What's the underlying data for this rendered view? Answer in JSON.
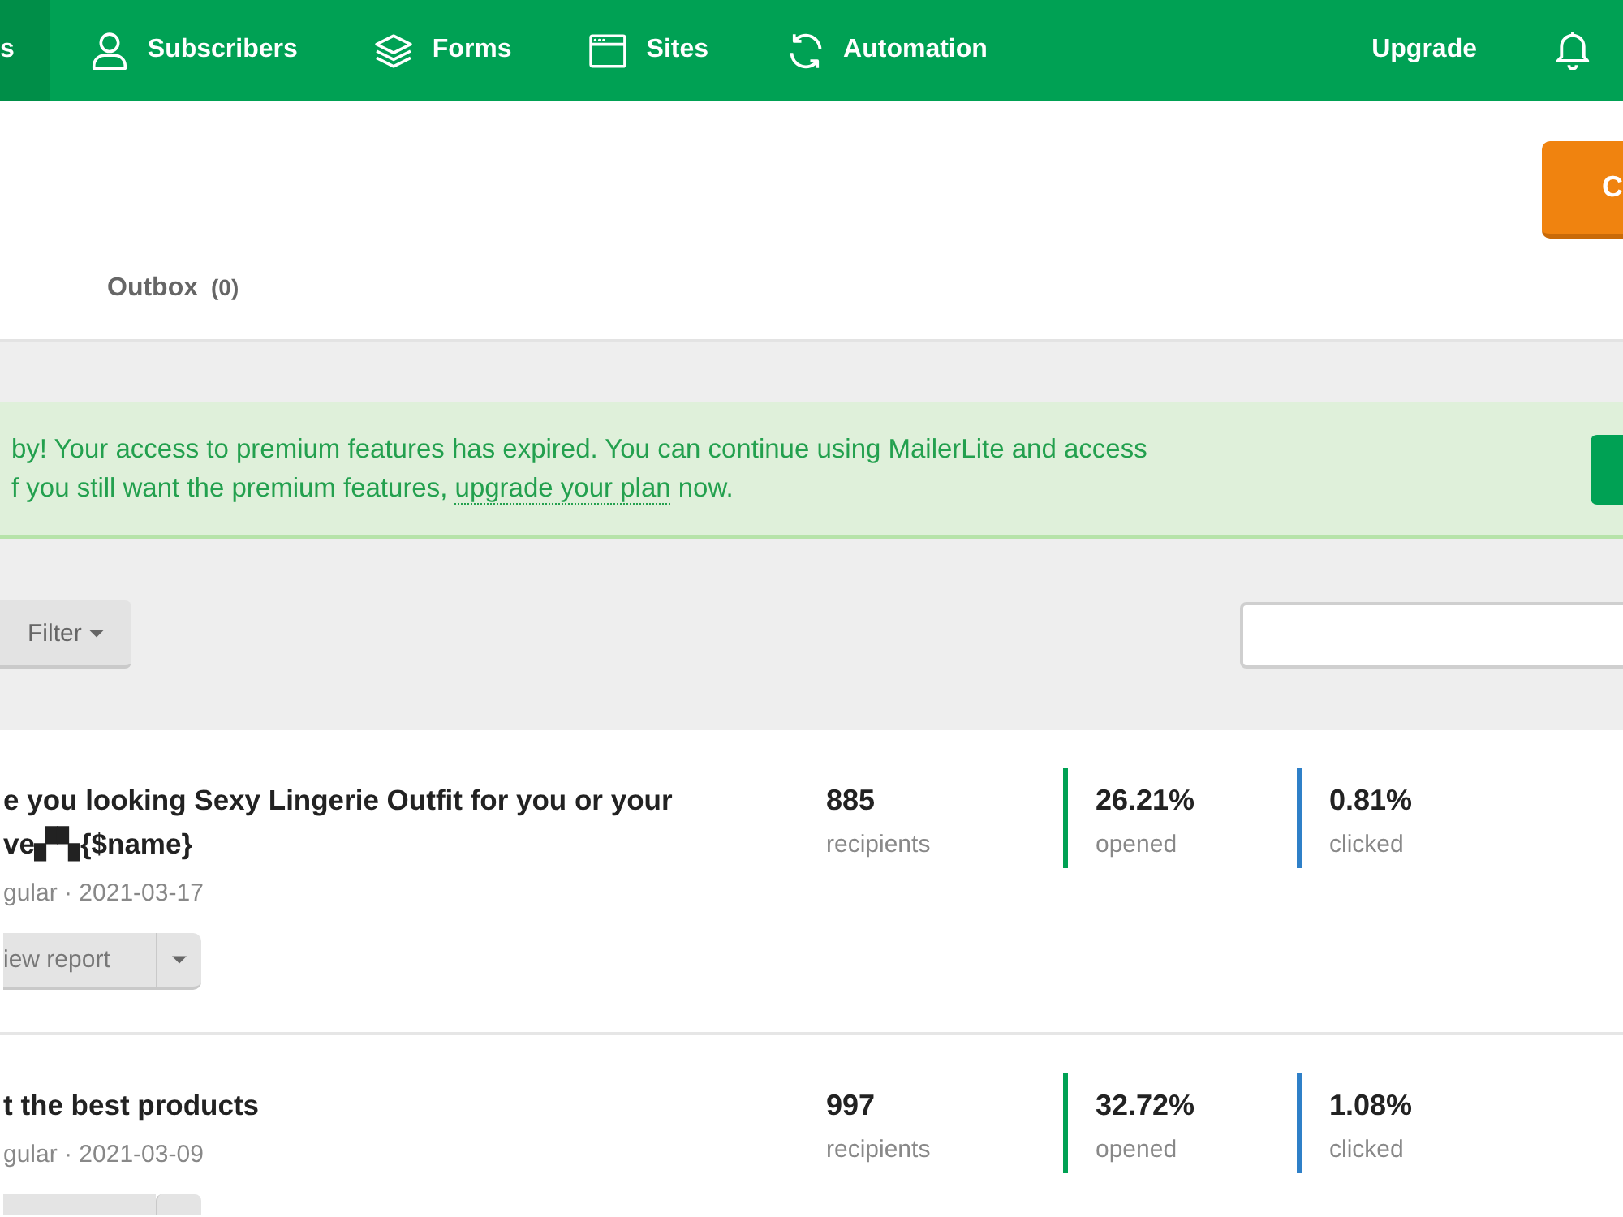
{
  "nav": {
    "tabs": [
      {
        "label": "s",
        "selected": true
      },
      {
        "label": "Subscribers",
        "selected": false
      },
      {
        "label": "Forms",
        "selected": false
      },
      {
        "label": "Sites",
        "selected": false
      },
      {
        "label": "Automation",
        "selected": false
      }
    ],
    "upgrade": "Upgrade"
  },
  "header": {
    "create_button": "C",
    "tabs": [
      {
        "label": "Outbox",
        "count": "(0)",
        "selected": false
      }
    ]
  },
  "alert": {
    "line_1": "by! Your access to premium features has expired. You can continue using MailerLite and access",
    "line_2": {
      "before": "f you still want the premium features, ",
      "link": "upgrade your plan",
      "after": " now."
    }
  },
  "toolbar": {
    "filter_button": "Filter"
  },
  "campaigns": [
    {
      "title_lines": [
        "e you looking Sexy Lingerie Outfit for you or your",
        "ve▞▚{$name}"
      ],
      "meta": "gular · 2021-03-17",
      "report_button": "iew report",
      "stats": [
        {
          "value": "885",
          "label": "recipients"
        },
        {
          "value": "26.21%",
          "label": "opened",
          "color": "#00a154"
        },
        {
          "value": "0.81%",
          "label": "clicked",
          "color": "#2f80c8"
        }
      ]
    },
    {
      "title_lines": [
        "t the best products"
      ],
      "meta": "gular · 2021-03-09",
      "stats": [
        {
          "value": "997",
          "label": "recipients"
        },
        {
          "value": "32.72%",
          "label": "opened",
          "color": "#00a154"
        },
        {
          "value": "1.08%",
          "label": "clicked",
          "color": "#2f80c8"
        }
      ]
    }
  ]
}
